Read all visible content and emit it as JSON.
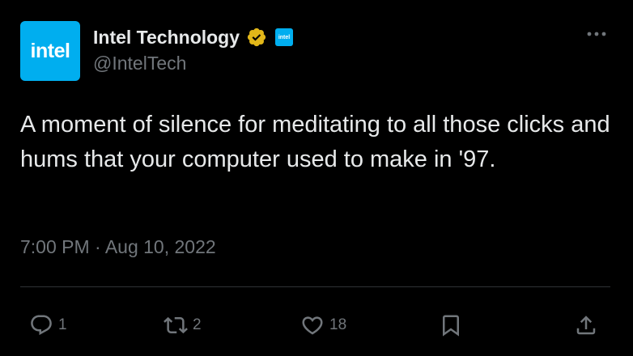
{
  "author": {
    "avatar_text": "intel",
    "display_name": "Intel Technology",
    "handle": "@IntelTech",
    "verified_badge": "gold-verified-check-icon",
    "affiliate_badge_text": "intel"
  },
  "tweet": {
    "text": "A moment of silence for meditating to all those clicks and hums that your computer used to make in '97.",
    "timestamp": "7:00 PM · Aug 10, 2022"
  },
  "actions": {
    "reply_count": "1",
    "retweet_count": "2",
    "like_count": "18"
  },
  "colors": {
    "background": "#000000",
    "text": "#e7e9ea",
    "muted": "#71767b",
    "intel_blue": "#00aeef",
    "verified_gold": "#e2b719",
    "divider": "#2f3336"
  }
}
